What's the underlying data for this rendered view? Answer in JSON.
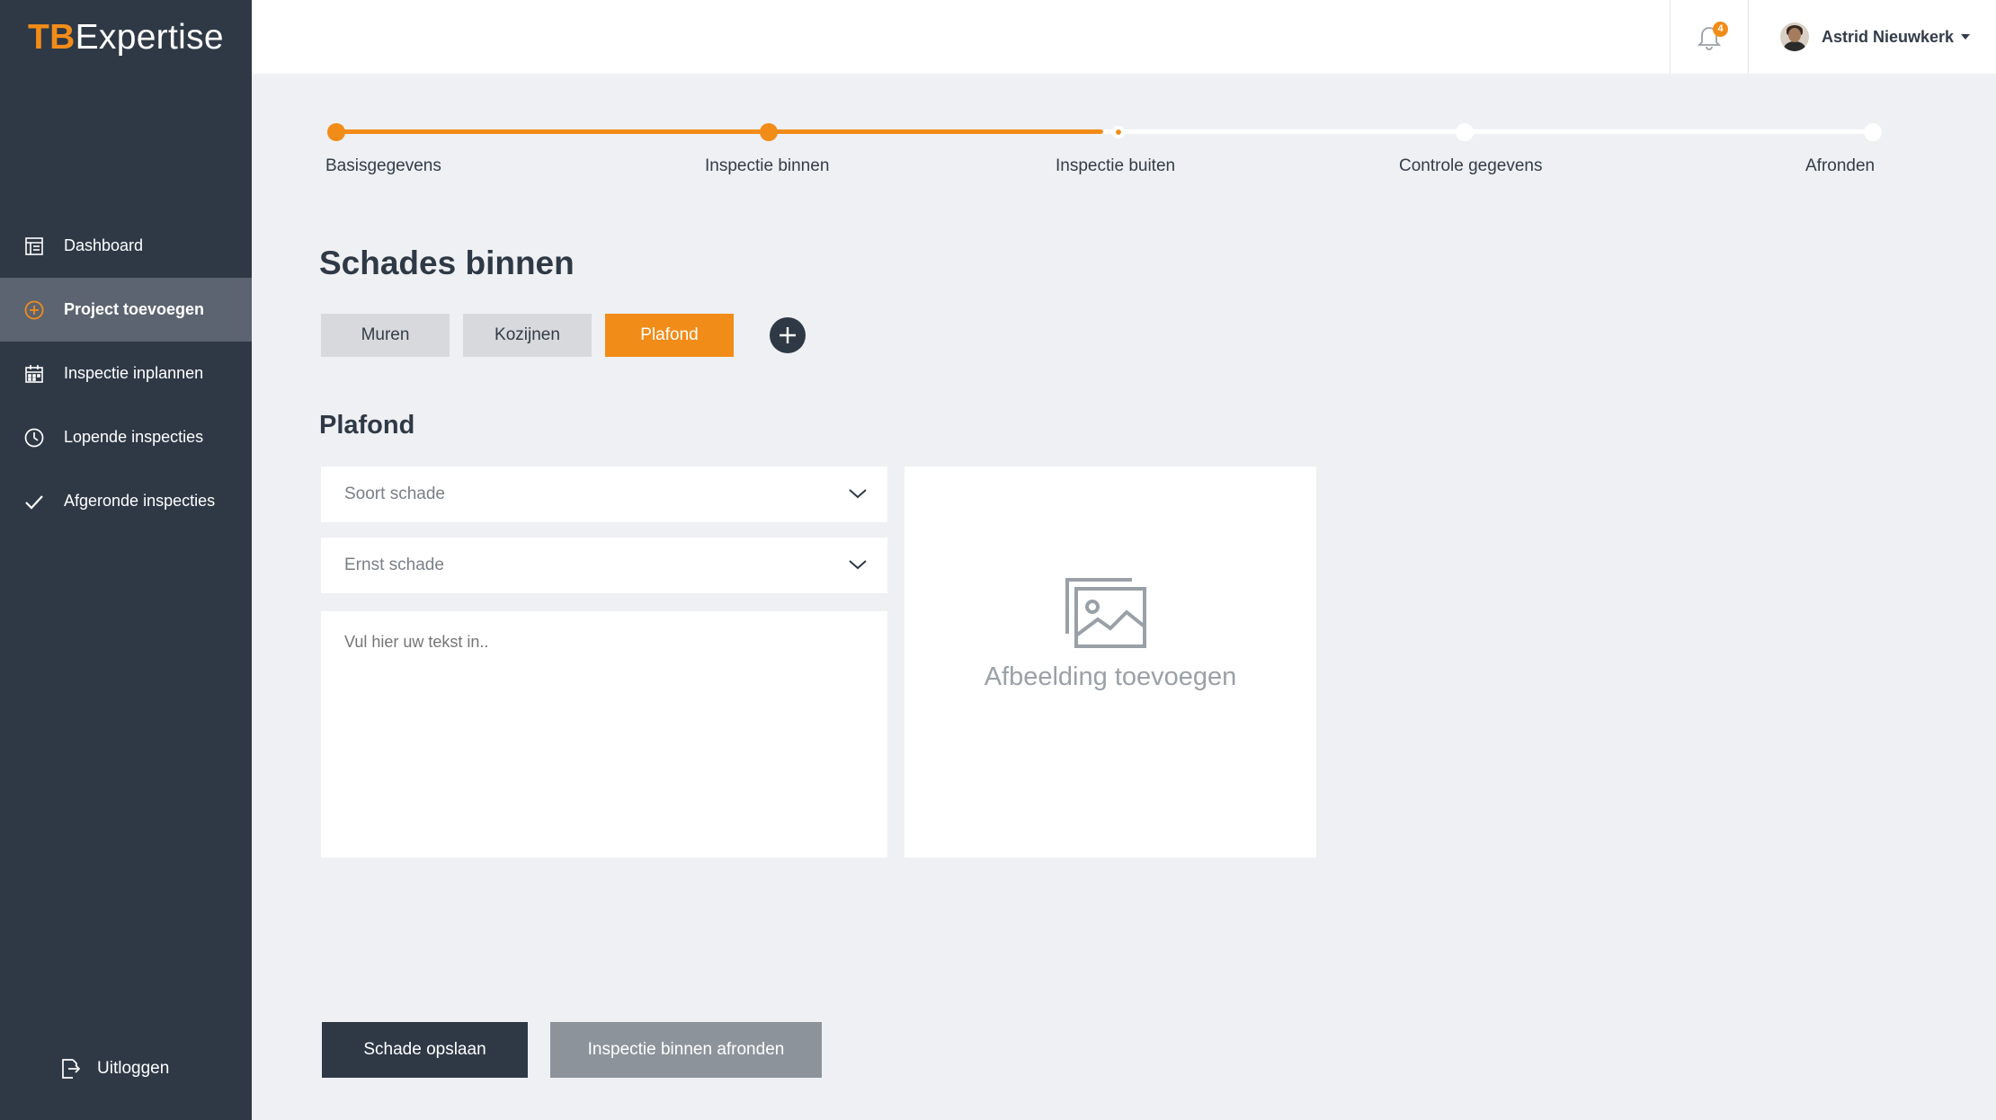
{
  "app": {
    "logo_prefix": "TB",
    "logo_suffix": "Expertise"
  },
  "sidebar": {
    "items": [
      {
        "label": "Dashboard",
        "icon": "dashboard-icon"
      },
      {
        "label": "Project toevoegen",
        "icon": "plus-circle-icon"
      },
      {
        "label": "Inspectie inplannen",
        "icon": "calendar-icon"
      },
      {
        "label": "Lopende inspecties",
        "icon": "clock-icon"
      },
      {
        "label": "Afgeronde inspecties",
        "icon": "check-icon"
      }
    ],
    "active_index": 1,
    "logout_label": "Uitloggen"
  },
  "header": {
    "notification_count": "4",
    "user_name": "Astrid Nieuwkerk"
  },
  "stepper": {
    "steps": [
      "Basisgegevens",
      "Inspectie binnen",
      "Inspectie buiten",
      "Controle gegevens",
      "Afronden"
    ],
    "completed_steps": 2,
    "current_step": 2
  },
  "main": {
    "title": "Schades binnen",
    "tabs": [
      "Muren",
      "Kozijnen",
      "Plafond"
    ],
    "active_tab": 2,
    "section_title": "Plafond",
    "damage_type_placeholder": "Soort schade",
    "severity_placeholder": "Ernst schade",
    "notes_placeholder": "Vul hier uw tekst in..",
    "image_label": "Afbeelding toevoegen",
    "save_button": "Schade opslaan",
    "finish_button": "Inspectie binnen afronden"
  },
  "colors": {
    "accent": "#f28c18",
    "sidebar": "#2f3946",
    "background": "#eef0f3"
  }
}
